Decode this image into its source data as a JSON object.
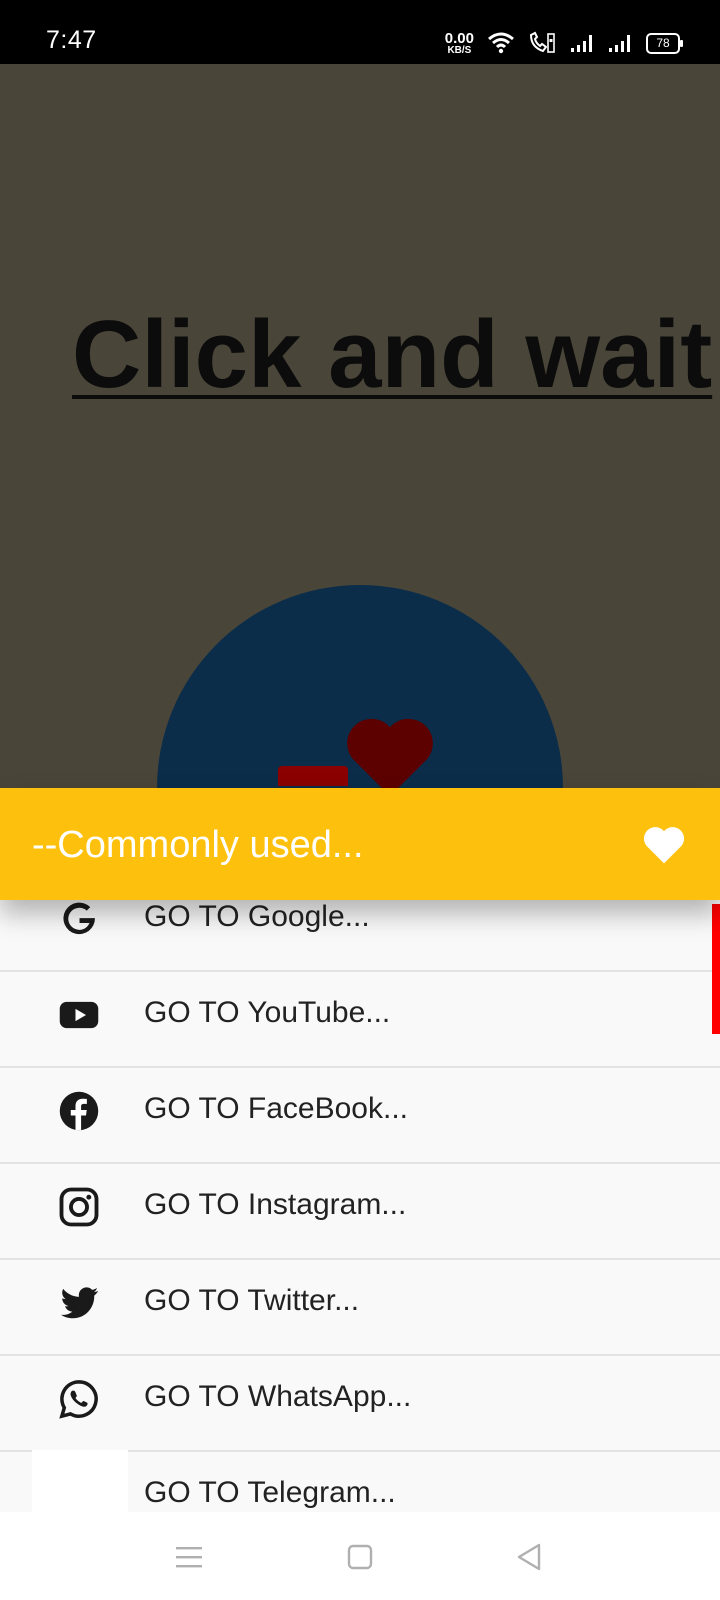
{
  "status_bar": {
    "time": "7:47",
    "net_speed_value": "0.00",
    "net_speed_unit": "KB/S",
    "battery": "78",
    "icons": [
      "wifi-icon",
      "volte-call-icon",
      "signal-icon",
      "signal-icon"
    ]
  },
  "main": {
    "headline": "Click and wait",
    "colors": {
      "background": "#4a4539",
      "circle": "#0b2d4a",
      "heart": "#5c0000"
    }
  },
  "section_header": {
    "title": "--Commonly used...",
    "icon": "heart-icon",
    "color": "#fdc10d"
  },
  "links": [
    {
      "label": "GO TO Google...",
      "icon": "google-icon"
    },
    {
      "label": "GO TO YouTube...",
      "icon": "youtube-icon"
    },
    {
      "label": "GO TO FaceBook...",
      "icon": "facebook-icon"
    },
    {
      "label": "GO TO Instagram...",
      "icon": "instagram-icon"
    },
    {
      "label": "GO TO Twitter...",
      "icon": "twitter-icon"
    },
    {
      "label": "GO TO WhatsApp...",
      "icon": "whatsapp-icon"
    },
    {
      "label": "GO TO Telegram...",
      "icon": ""
    }
  ],
  "nav_bar": {
    "icons": [
      "menu-icon",
      "home-icon",
      "back-icon"
    ]
  }
}
